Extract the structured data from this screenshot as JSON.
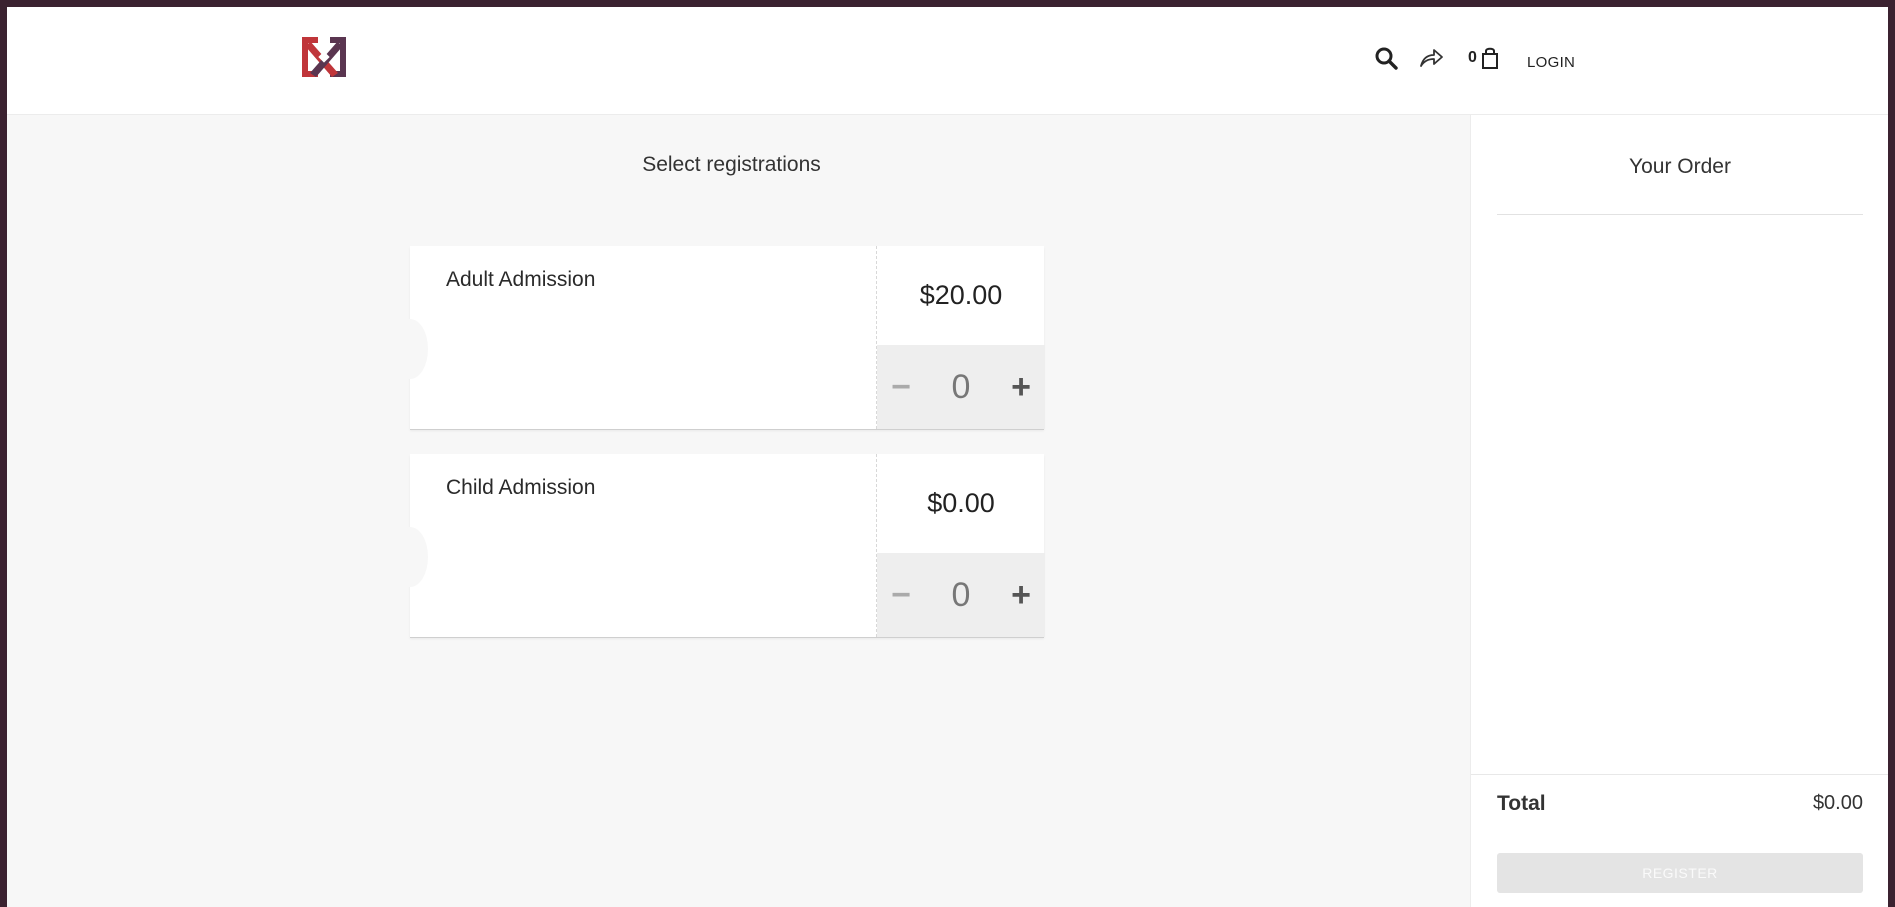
{
  "header": {
    "cart_count": "0",
    "login_label": "LOGIN",
    "brand_colors": [
      "#c0353a",
      "#5a3550"
    ],
    "icons": [
      "search-icon",
      "share-icon",
      "shopping-bag-icon"
    ]
  },
  "main": {
    "title": "Select registrations",
    "tickets": [
      {
        "name": "Adult Admission",
        "price": "$20.00",
        "quantity": "0",
        "minus": "−",
        "plus": "+"
      },
      {
        "name": "Child Admission",
        "price": "$0.00",
        "quantity": "0",
        "minus": "−",
        "plus": "+"
      }
    ]
  },
  "order": {
    "title": "Your Order",
    "total_label": "Total",
    "total_value": "$0.00",
    "register_label": "REGISTER"
  }
}
